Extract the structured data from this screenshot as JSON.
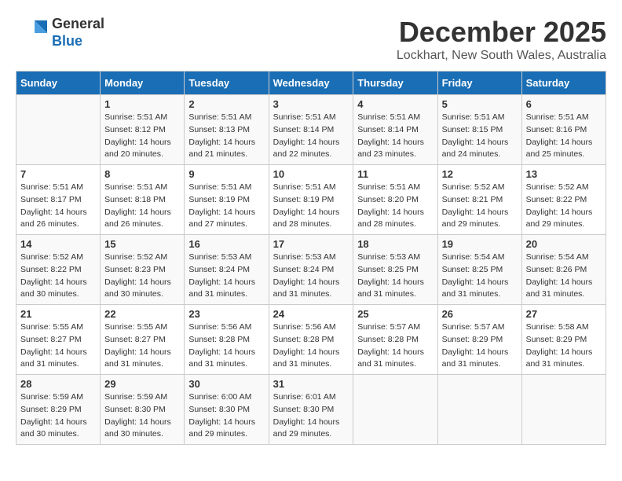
{
  "header": {
    "logo_line1": "General",
    "logo_line2": "Blue",
    "month": "December 2025",
    "location": "Lockhart, New South Wales, Australia"
  },
  "days_of_week": [
    "Sunday",
    "Monday",
    "Tuesday",
    "Wednesday",
    "Thursday",
    "Friday",
    "Saturday"
  ],
  "weeks": [
    [
      {
        "day": "",
        "info": ""
      },
      {
        "day": "1",
        "info": "Sunrise: 5:51 AM\nSunset: 8:12 PM\nDaylight: 14 hours\nand 20 minutes."
      },
      {
        "day": "2",
        "info": "Sunrise: 5:51 AM\nSunset: 8:13 PM\nDaylight: 14 hours\nand 21 minutes."
      },
      {
        "day": "3",
        "info": "Sunrise: 5:51 AM\nSunset: 8:14 PM\nDaylight: 14 hours\nand 22 minutes."
      },
      {
        "day": "4",
        "info": "Sunrise: 5:51 AM\nSunset: 8:14 PM\nDaylight: 14 hours\nand 23 minutes."
      },
      {
        "day": "5",
        "info": "Sunrise: 5:51 AM\nSunset: 8:15 PM\nDaylight: 14 hours\nand 24 minutes."
      },
      {
        "day": "6",
        "info": "Sunrise: 5:51 AM\nSunset: 8:16 PM\nDaylight: 14 hours\nand 25 minutes."
      }
    ],
    [
      {
        "day": "7",
        "info": "Sunrise: 5:51 AM\nSunset: 8:17 PM\nDaylight: 14 hours\nand 26 minutes."
      },
      {
        "day": "8",
        "info": "Sunrise: 5:51 AM\nSunset: 8:18 PM\nDaylight: 14 hours\nand 26 minutes."
      },
      {
        "day": "9",
        "info": "Sunrise: 5:51 AM\nSunset: 8:19 PM\nDaylight: 14 hours\nand 27 minutes."
      },
      {
        "day": "10",
        "info": "Sunrise: 5:51 AM\nSunset: 8:19 PM\nDaylight: 14 hours\nand 28 minutes."
      },
      {
        "day": "11",
        "info": "Sunrise: 5:51 AM\nSunset: 8:20 PM\nDaylight: 14 hours\nand 28 minutes."
      },
      {
        "day": "12",
        "info": "Sunrise: 5:52 AM\nSunset: 8:21 PM\nDaylight: 14 hours\nand 29 minutes."
      },
      {
        "day": "13",
        "info": "Sunrise: 5:52 AM\nSunset: 8:22 PM\nDaylight: 14 hours\nand 29 minutes."
      }
    ],
    [
      {
        "day": "14",
        "info": "Sunrise: 5:52 AM\nSunset: 8:22 PM\nDaylight: 14 hours\nand 30 minutes."
      },
      {
        "day": "15",
        "info": "Sunrise: 5:52 AM\nSunset: 8:23 PM\nDaylight: 14 hours\nand 30 minutes."
      },
      {
        "day": "16",
        "info": "Sunrise: 5:53 AM\nSunset: 8:24 PM\nDaylight: 14 hours\nand 31 minutes."
      },
      {
        "day": "17",
        "info": "Sunrise: 5:53 AM\nSunset: 8:24 PM\nDaylight: 14 hours\nand 31 minutes."
      },
      {
        "day": "18",
        "info": "Sunrise: 5:53 AM\nSunset: 8:25 PM\nDaylight: 14 hours\nand 31 minutes."
      },
      {
        "day": "19",
        "info": "Sunrise: 5:54 AM\nSunset: 8:25 PM\nDaylight: 14 hours\nand 31 minutes."
      },
      {
        "day": "20",
        "info": "Sunrise: 5:54 AM\nSunset: 8:26 PM\nDaylight: 14 hours\nand 31 minutes."
      }
    ],
    [
      {
        "day": "21",
        "info": "Sunrise: 5:55 AM\nSunset: 8:27 PM\nDaylight: 14 hours\nand 31 minutes."
      },
      {
        "day": "22",
        "info": "Sunrise: 5:55 AM\nSunset: 8:27 PM\nDaylight: 14 hours\nand 31 minutes."
      },
      {
        "day": "23",
        "info": "Sunrise: 5:56 AM\nSunset: 8:28 PM\nDaylight: 14 hours\nand 31 minutes."
      },
      {
        "day": "24",
        "info": "Sunrise: 5:56 AM\nSunset: 8:28 PM\nDaylight: 14 hours\nand 31 minutes."
      },
      {
        "day": "25",
        "info": "Sunrise: 5:57 AM\nSunset: 8:28 PM\nDaylight: 14 hours\nand 31 minutes."
      },
      {
        "day": "26",
        "info": "Sunrise: 5:57 AM\nSunset: 8:29 PM\nDaylight: 14 hours\nand 31 minutes."
      },
      {
        "day": "27",
        "info": "Sunrise: 5:58 AM\nSunset: 8:29 PM\nDaylight: 14 hours\nand 31 minutes."
      }
    ],
    [
      {
        "day": "28",
        "info": "Sunrise: 5:59 AM\nSunset: 8:29 PM\nDaylight: 14 hours\nand 30 minutes."
      },
      {
        "day": "29",
        "info": "Sunrise: 5:59 AM\nSunset: 8:30 PM\nDaylight: 14 hours\nand 30 minutes."
      },
      {
        "day": "30",
        "info": "Sunrise: 6:00 AM\nSunset: 8:30 PM\nDaylight: 14 hours\nand 29 minutes."
      },
      {
        "day": "31",
        "info": "Sunrise: 6:01 AM\nSunset: 8:30 PM\nDaylight: 14 hours\nand 29 minutes."
      },
      {
        "day": "",
        "info": ""
      },
      {
        "day": "",
        "info": ""
      },
      {
        "day": "",
        "info": ""
      }
    ]
  ]
}
